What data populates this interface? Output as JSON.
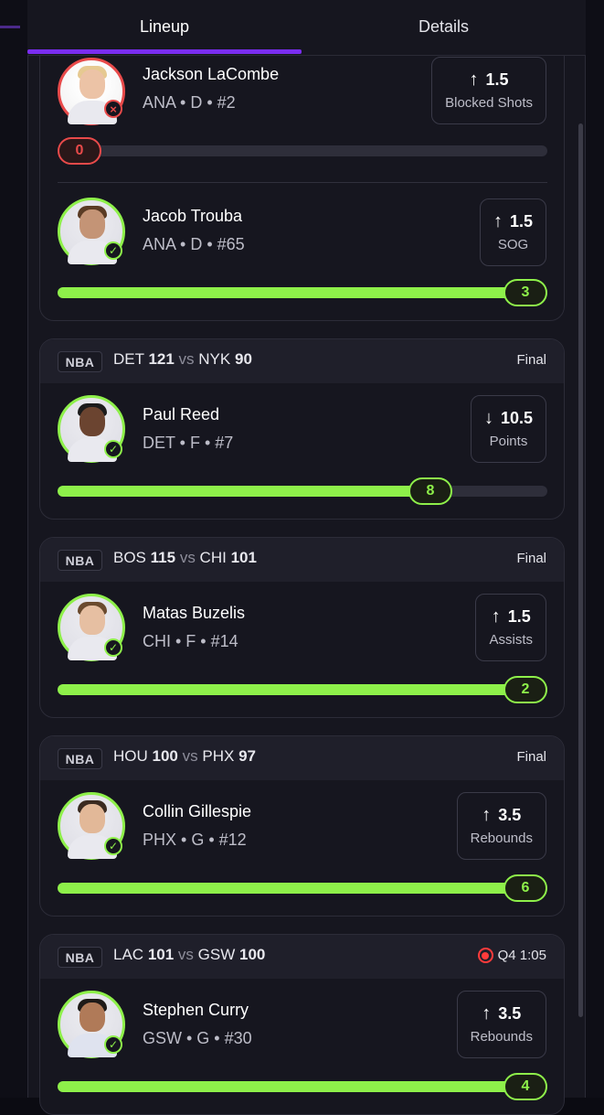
{
  "tabs": [
    {
      "label": "Lineup",
      "active": true
    },
    {
      "label": "Details",
      "active": false
    }
  ],
  "colors": {
    "accent": "#7a2df0",
    "hit": "#8ef04a",
    "miss": "#e84a4a",
    "live": "#ff3b3b"
  },
  "card0": {
    "players": [
      {
        "name": "Jackson LaCombe",
        "meta": "ANA • D • #2",
        "direction": "up",
        "arrow": "↑",
        "line": "1.5",
        "stat": "Blocked Shots",
        "result": "0",
        "status_icon": "x-icon",
        "badge": "×",
        "progress": 0
      },
      {
        "name": "Jacob Trouba",
        "meta": "ANA • D • #65",
        "direction": "up",
        "arrow": "↑",
        "line": "1.5",
        "stat": "SOG",
        "result": "3",
        "status_icon": "check-icon",
        "badge": "✓",
        "progress": 1
      }
    ]
  },
  "cards": [
    {
      "league": "NBA",
      "home": "DET",
      "home_score": "121",
      "vs": "vs",
      "away": "NYK",
      "away_score": "90",
      "status": "Final",
      "player": {
        "name": "Paul Reed",
        "meta": "DET • F • #7",
        "direction": "down",
        "arrow": "↓",
        "line": "10.5",
        "stat": "Points",
        "result": "8",
        "badge": "✓",
        "progress": 0.76
      }
    },
    {
      "league": "NBA",
      "home": "BOS",
      "home_score": "115",
      "vs": "vs",
      "away": "CHI",
      "away_score": "101",
      "status": "Final",
      "player": {
        "name": "Matas Buzelis",
        "meta": "CHI • F • #14",
        "direction": "up",
        "arrow": "↑",
        "line": "1.5",
        "stat": "Assists",
        "result": "2",
        "badge": "✓",
        "progress": 1
      }
    },
    {
      "league": "NBA",
      "home": "HOU",
      "home_score": "100",
      "vs": "vs",
      "away": "PHX",
      "away_score": "97",
      "status": "Final",
      "player": {
        "name": "Collin Gillespie",
        "meta": "PHX • G • #12",
        "direction": "up",
        "arrow": "↑",
        "line": "3.5",
        "stat": "Rebounds",
        "result": "6",
        "badge": "✓",
        "progress": 1
      }
    },
    {
      "league": "NBA",
      "home": "LAC",
      "home_score": "101",
      "vs": "vs",
      "away": "GSW",
      "away_score": "100",
      "status": "Q4 1:05",
      "live": true,
      "player": {
        "name": "Stephen Curry",
        "meta": "GSW • G • #30",
        "direction": "up",
        "arrow": "↑",
        "line": "3.5",
        "stat": "Rebounds",
        "result": "4",
        "badge": "✓",
        "progress": 1
      }
    }
  ]
}
